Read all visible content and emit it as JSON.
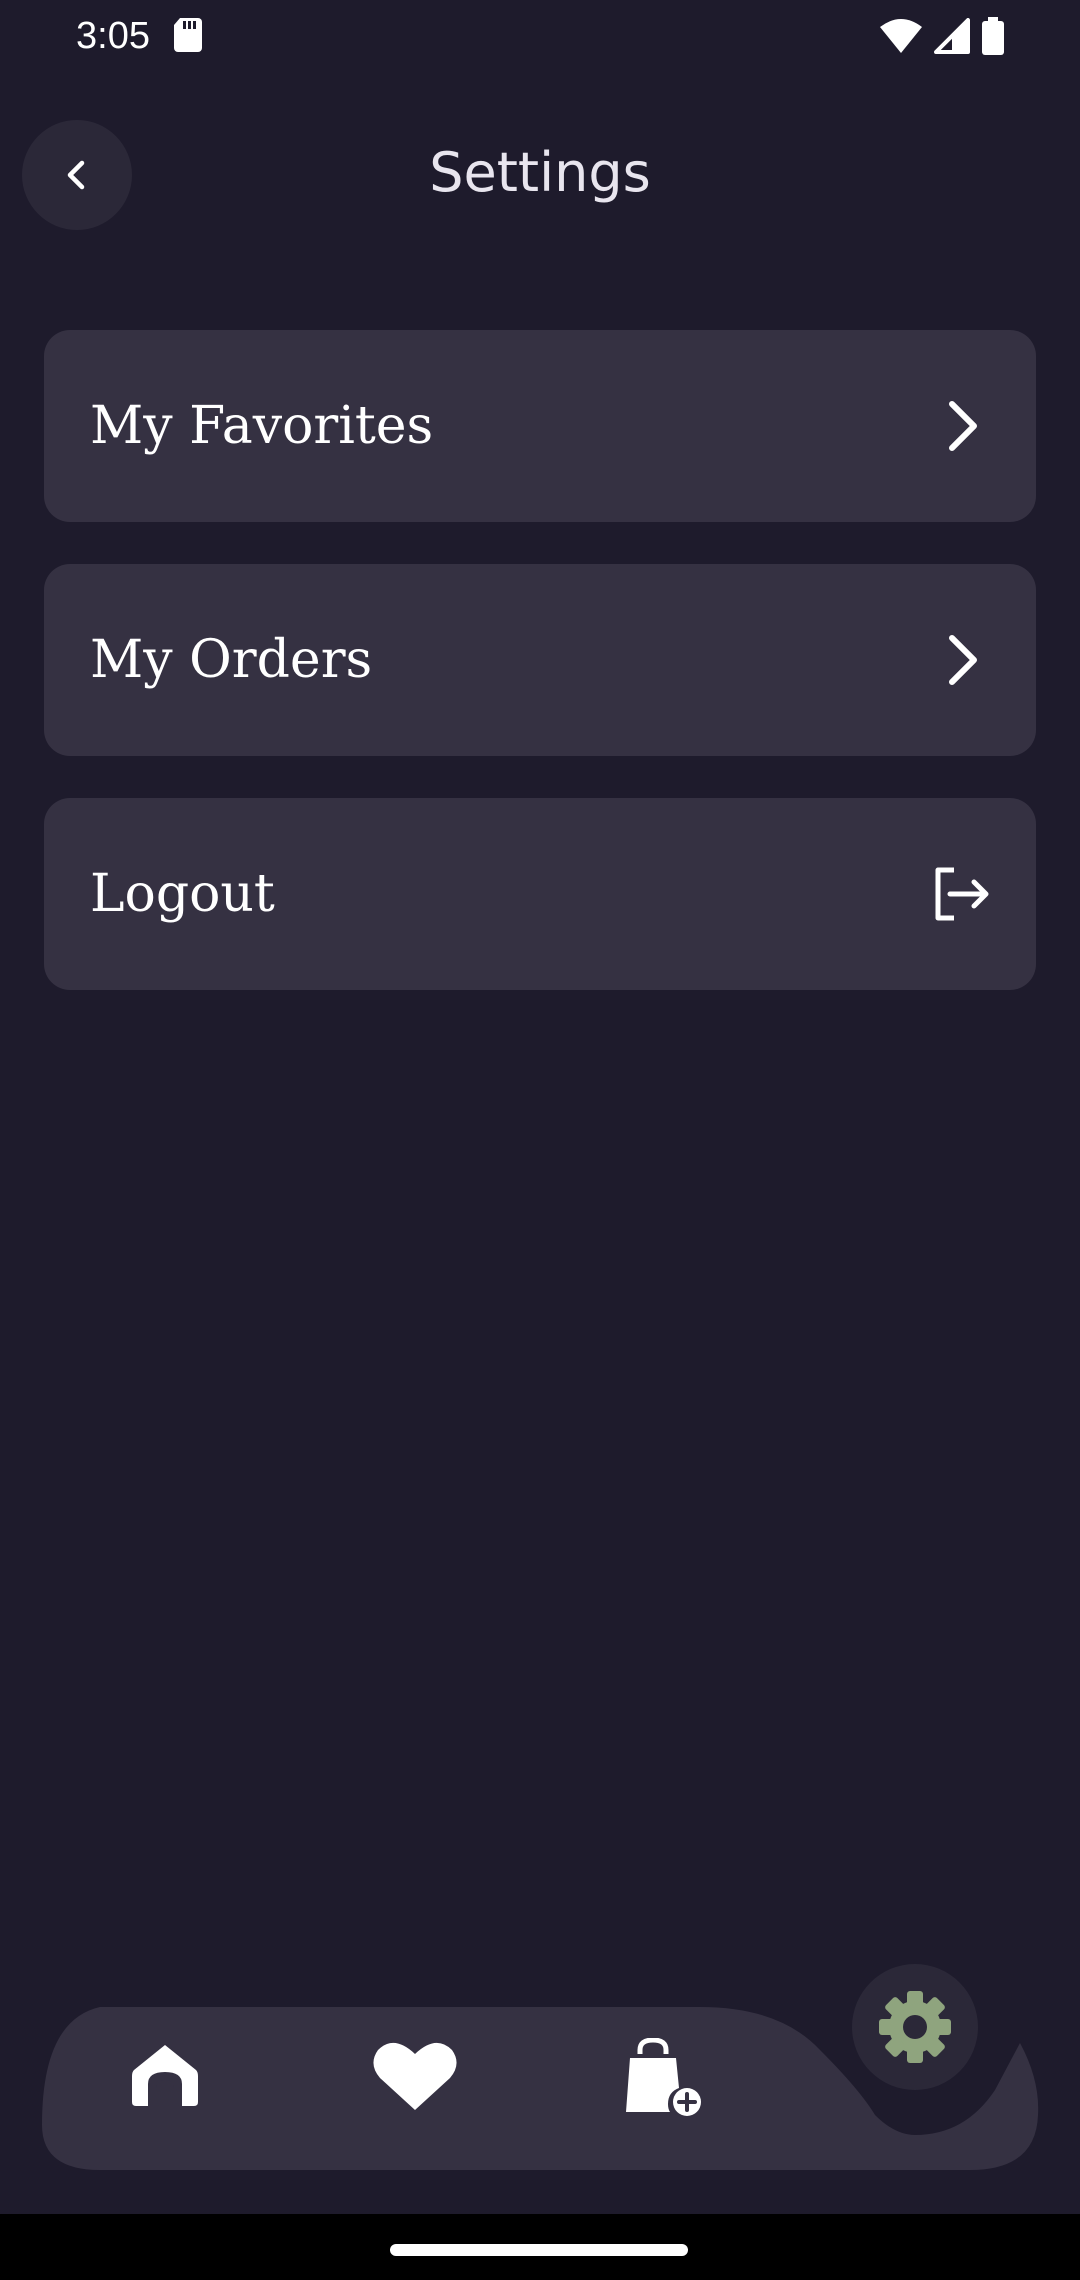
{
  "status_bar": {
    "time": "3:05",
    "icons": [
      "sd-card-icon",
      "wifi-icon",
      "signal-icon",
      "battery-icon"
    ]
  },
  "header": {
    "title": "Settings",
    "back_icon": "chevron-left-icon"
  },
  "menu": {
    "items": [
      {
        "label": "My Favorites",
        "icon": "chevron-right-icon"
      },
      {
        "label": "My Orders",
        "icon": "chevron-right-icon"
      },
      {
        "label": "Logout",
        "icon": "logout-icon"
      }
    ]
  },
  "bottom_nav": {
    "items": [
      {
        "name": "home",
        "icon": "home-icon"
      },
      {
        "name": "favorites",
        "icon": "heart-icon"
      },
      {
        "name": "cart",
        "icon": "shopping-bag-add-icon"
      },
      {
        "name": "settings",
        "icon": "gear-icon",
        "active": true
      }
    ]
  },
  "colors": {
    "background": "#1e1b2c",
    "card": "#353142",
    "accent": "#8fa47e",
    "text": "#ffffff"
  }
}
